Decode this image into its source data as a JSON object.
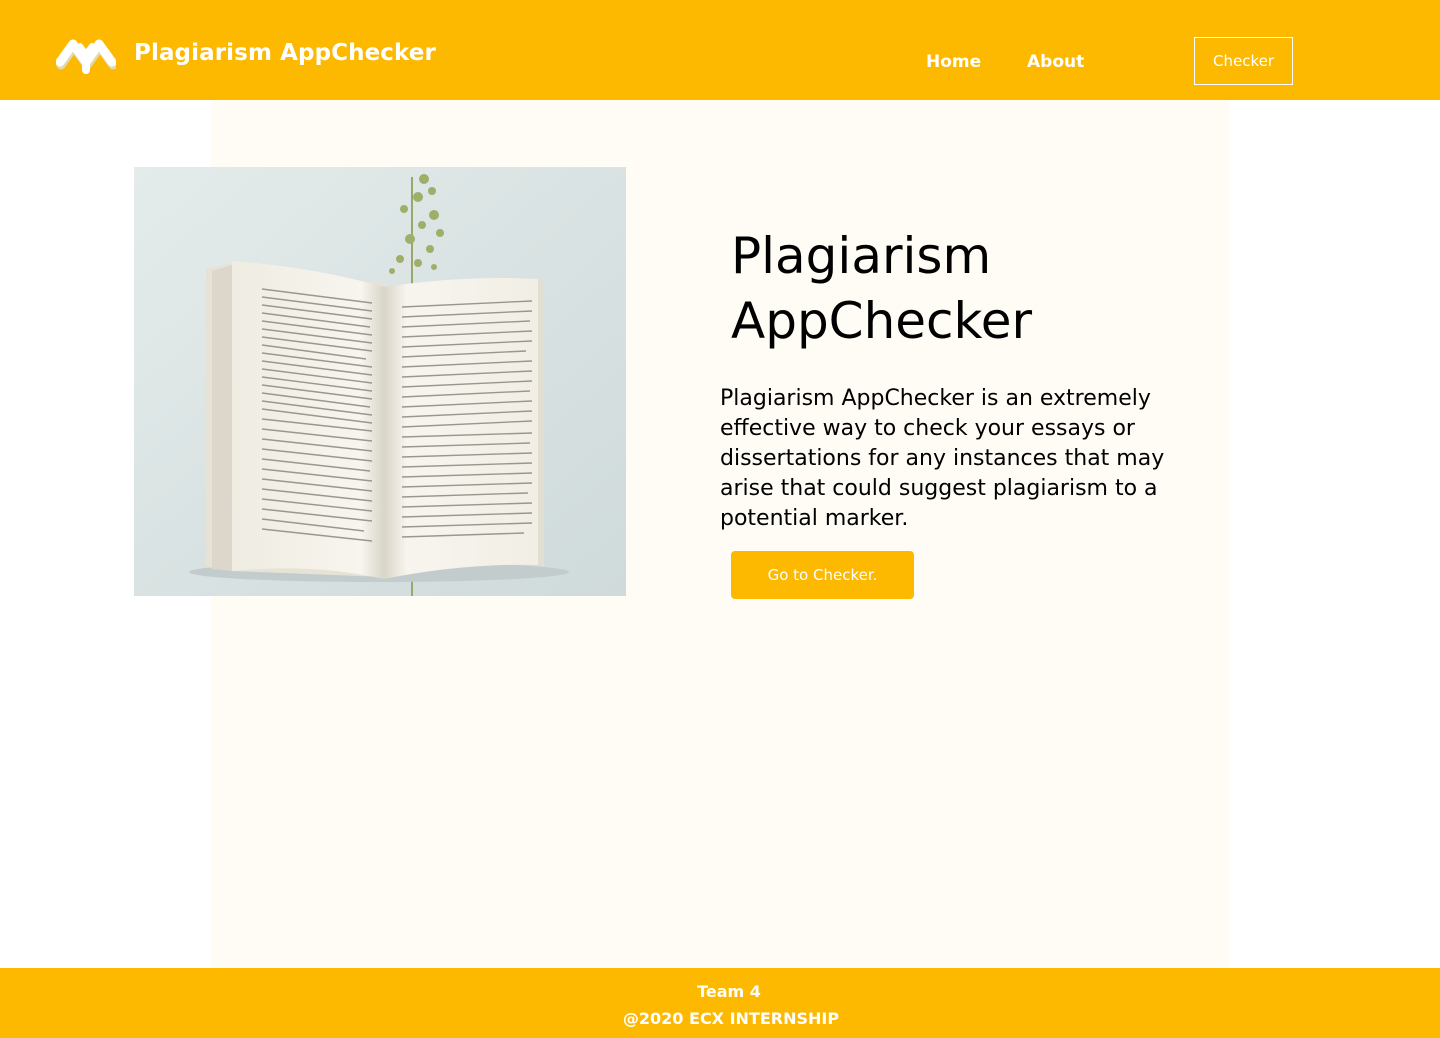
{
  "header": {
    "brand": "Plagiarism AppChecker",
    "logo_icon": "mountain-logo-icon",
    "nav": {
      "home": "Home",
      "about": "About",
      "checker": "Checker"
    }
  },
  "hero": {
    "title": "Plagiarism AppChecker",
    "description": " Plagiarism AppChecker is an extremely effective way to check your essays or dissertations for any instances that may arise that could suggest plagiarism to a potential marker.",
    "cta": "Go to Checker.",
    "image_icon": "open-book-photo"
  },
  "footer": {
    "team": "Team 4",
    "copyright": "@2020 ECX INTERNSHIP"
  },
  "colors": {
    "accent": "#fdb900",
    "main_background": "#fefcf5",
    "text": "#000000"
  }
}
